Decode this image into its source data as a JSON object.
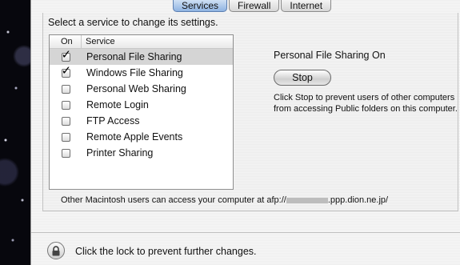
{
  "tabs": [
    {
      "label": "Services",
      "selected": true
    },
    {
      "label": "Firewall",
      "selected": false
    },
    {
      "label": "Internet",
      "selected": false
    }
  ],
  "instruction": "Select a service to change its settings.",
  "list": {
    "columns": {
      "on": "On",
      "service": "Service"
    },
    "rows": [
      {
        "label": "Personal File Sharing",
        "checked": true,
        "selected": true
      },
      {
        "label": "Windows File Sharing",
        "checked": true,
        "selected": false
      },
      {
        "label": "Personal Web Sharing",
        "checked": false,
        "selected": false
      },
      {
        "label": "Remote Login",
        "checked": false,
        "selected": false
      },
      {
        "label": "FTP Access",
        "checked": false,
        "selected": false
      },
      {
        "label": "Remote Apple Events",
        "checked": false,
        "selected": false
      },
      {
        "label": "Printer Sharing",
        "checked": false,
        "selected": false
      }
    ]
  },
  "status": {
    "title": "Personal File Sharing On",
    "button_label": "Stop",
    "help_text": "Click Stop to prevent users of other computers from accessing Public folders on this computer."
  },
  "afp": {
    "prefix": "Other Macintosh users can access your computer at afp://",
    "suffix": ".ppp.dion.ne.jp/"
  },
  "lock": {
    "icon": "lock-icon",
    "caption": "Click the lock to prevent further changes."
  },
  "colors": {
    "selected_tab": "#8fb3e2",
    "selected_row": "#d5d5d5"
  }
}
